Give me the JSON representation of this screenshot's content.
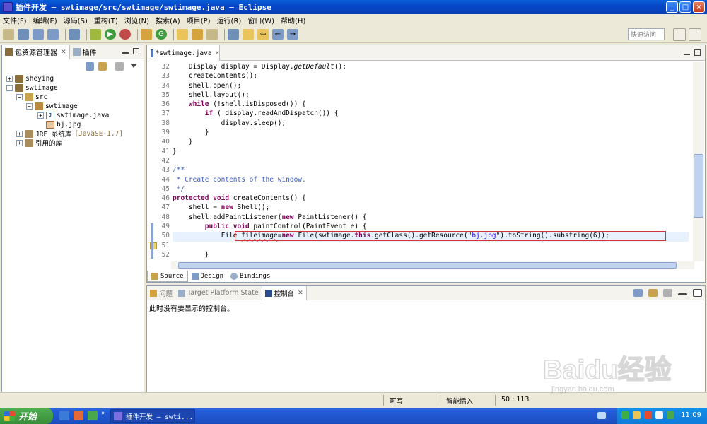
{
  "window": {
    "title": "插件开发 — swtimage/src/swtimage/swtimage.java — Eclipse",
    "controls": [
      "_",
      "□",
      "×"
    ]
  },
  "menu": [
    "文件(F)",
    "编辑(E)",
    "源码(S)",
    "重构(T)",
    "浏览(N)",
    "搜索(A)",
    "项目(P)",
    "运行(R)",
    "窗口(W)",
    "帮助(H)"
  ],
  "toolbar": {
    "quick_access_placeholder": "快速访问"
  },
  "package_explorer": {
    "tab_label": "包资源管理器",
    "tab2_label": "插件",
    "tree": [
      {
        "label": "sheying",
        "expander": "+",
        "icon": "project-icon",
        "indent": 0
      },
      {
        "label": "swtimage",
        "expander": "−",
        "icon": "project-icon",
        "indent": 0
      },
      {
        "label": "src",
        "expander": "−",
        "icon": "source-folder-icon",
        "indent": 1
      },
      {
        "label": "swtimage",
        "expander": "−",
        "icon": "package-icon",
        "indent": 2
      },
      {
        "label": "swtimage.java",
        "expander": "+",
        "icon": "java-file-icon",
        "indent": 3
      },
      {
        "label": "bj.jpg",
        "expander": "",
        "icon": "image-file-icon",
        "indent": 3
      },
      {
        "label": "JRE 系统库",
        "extra": "[JavaSE-1.7]",
        "expander": "+",
        "icon": "library-icon",
        "indent": 1
      },
      {
        "label": "引用的库",
        "expander": "+",
        "icon": "library-icon",
        "indent": 1
      }
    ]
  },
  "editor": {
    "tab_label": "*swtimage.java",
    "line_numbers": [
      "32",
      "33",
      "34",
      "35",
      "36",
      "37",
      "38",
      "39",
      "40",
      "41",
      "42",
      "43",
      "44",
      "45",
      "46",
      "47",
      "48",
      "49",
      "50",
      "51",
      "52"
    ],
    "bottom_tabs": [
      "Source",
      "Design",
      "Bindings"
    ]
  },
  "console": {
    "tabs": [
      "问题",
      "Target Platform State",
      "控制台"
    ],
    "message": "此时没有要显示的控制台。"
  },
  "status": {
    "writable": "可写",
    "insert_mode": "智能插入",
    "position": "50 : 113"
  },
  "taskbar": {
    "start_label": "开始",
    "task_label": "插件开发 — swti...",
    "clock": "11:09"
  },
  "watermark": {
    "text": "Baidu经验",
    "url": "jingyan.baidu.com"
  },
  "colors": {
    "keyword": "#7F0055",
    "string": "#2A00FF",
    "comment": "#3F5FBF",
    "title_bar": "#0A3FB5",
    "error_box": "#D4333A"
  }
}
